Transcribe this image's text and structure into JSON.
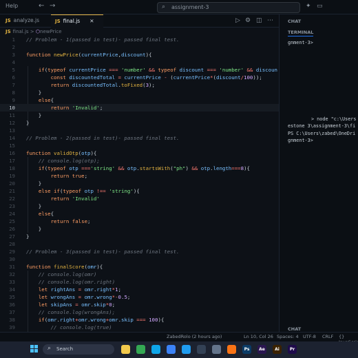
{
  "titlebar": {
    "menu_label": "Help",
    "back_label": "←",
    "forward_label": "→",
    "search_text": "assignment-3"
  },
  "tabs": [
    {
      "icon": "JS",
      "label": "analyze.js"
    },
    {
      "icon": "JS",
      "label": "final.js",
      "close": "✕"
    }
  ],
  "breadcrumb": {
    "icon": "JS",
    "file": "final.js",
    "separator": ">",
    "symbol": "newPrice"
  },
  "editor": {
    "cursor_line": 10,
    "lines": [
      {
        "n": "1",
        "t": [
          [
            "c",
            "// Problem - 1(passed in test)- passed final test."
          ]
        ]
      },
      {
        "n": "2",
        "t": []
      },
      {
        "n": "3",
        "t": [
          [
            "k",
            "function "
          ],
          [
            "f",
            "newPrice"
          ],
          [
            "p",
            "("
          ],
          [
            "v",
            "currentPrice"
          ],
          [
            "p",
            ","
          ],
          [
            "v",
            "discount"
          ],
          [
            "p",
            "){"
          ]
        ]
      },
      {
        "n": "4",
        "t": []
      },
      {
        "n": "5",
        "t": [
          [
            "p",
            "    "
          ],
          [
            "k",
            "if"
          ],
          [
            "p",
            "("
          ],
          [
            "k",
            "typeof "
          ],
          [
            "v",
            "currentPrice "
          ],
          [
            "o",
            "=== "
          ],
          [
            "s",
            "'number' "
          ],
          [
            "o",
            "&& "
          ],
          [
            "k",
            "typeof "
          ],
          [
            "v",
            "discount "
          ],
          [
            "o",
            "=== "
          ],
          [
            "s",
            "'number' "
          ],
          [
            "o",
            "&& "
          ],
          [
            "v",
            "discoun"
          ]
        ]
      },
      {
        "n": "6",
        "t": [
          [
            "p",
            "        "
          ],
          [
            "k",
            "const "
          ],
          [
            "v",
            "discountedTotal "
          ],
          [
            "o",
            "= "
          ],
          [
            "v",
            "currentPrice "
          ],
          [
            "o",
            "- "
          ],
          [
            "p",
            "("
          ],
          [
            "v",
            "currentPrice"
          ],
          [
            "o",
            "*"
          ],
          [
            "p",
            "("
          ],
          [
            "v",
            "discount"
          ],
          [
            "o",
            "/"
          ],
          [
            "n",
            "100"
          ],
          [
            "p",
            "));"
          ]
        ]
      },
      {
        "n": "7",
        "t": [
          [
            "p",
            "        "
          ],
          [
            "k",
            "return "
          ],
          [
            "v",
            "discountedTotal"
          ],
          [
            "p",
            "."
          ],
          [
            "f",
            "toFixed"
          ],
          [
            "p",
            "("
          ],
          [
            "n",
            "3"
          ],
          [
            "p",
            ");"
          ]
        ]
      },
      {
        "n": "8",
        "t": [
          [
            "p",
            "    }"
          ]
        ]
      },
      {
        "n": "9",
        "t": [
          [
            "p",
            "    "
          ],
          [
            "k",
            "else"
          ],
          [
            "p",
            "{"
          ]
        ]
      },
      {
        "n": "10",
        "t": [
          [
            "p",
            "        "
          ],
          [
            "k",
            "return "
          ],
          [
            "s",
            "'Invalid'"
          ],
          [
            "p",
            ";"
          ]
        ]
      },
      {
        "n": "11",
        "t": [
          [
            "p",
            "    }"
          ]
        ]
      },
      {
        "n": "12",
        "t": [
          [
            "p",
            "}"
          ]
        ]
      },
      {
        "n": "13",
        "t": []
      },
      {
        "n": "14",
        "t": [
          [
            "c",
            "// Problem - 2(passed in test)- passed final test."
          ]
        ]
      },
      {
        "n": "15",
        "t": []
      },
      {
        "n": "16",
        "t": [
          [
            "k",
            "function "
          ],
          [
            "f",
            "validOtp"
          ],
          [
            "p",
            "("
          ],
          [
            "v",
            "otp"
          ],
          [
            "p",
            "){"
          ]
        ]
      },
      {
        "n": "17",
        "t": [
          [
            "p",
            "    "
          ],
          [
            "c",
            "// console.log(otp);"
          ]
        ]
      },
      {
        "n": "18",
        "t": [
          [
            "p",
            "    "
          ],
          [
            "k",
            "if"
          ],
          [
            "p",
            "("
          ],
          [
            "k",
            "typeof "
          ],
          [
            "v",
            "otp "
          ],
          [
            "o",
            "==="
          ],
          [
            "s",
            "'string' "
          ],
          [
            "o",
            "&& "
          ],
          [
            "v",
            "otp"
          ],
          [
            "p",
            "."
          ],
          [
            "f",
            "startsWith"
          ],
          [
            "p",
            "("
          ],
          [
            "s",
            "\"ph\""
          ],
          [
            "p",
            ") "
          ],
          [
            "o",
            "&& "
          ],
          [
            "v",
            "otp"
          ],
          [
            "p",
            "."
          ],
          [
            "v",
            "length"
          ],
          [
            "o",
            "==="
          ],
          [
            "n",
            "8"
          ],
          [
            "p",
            "){"
          ]
        ]
      },
      {
        "n": "19",
        "t": [
          [
            "p",
            "        "
          ],
          [
            "k",
            "return "
          ],
          [
            "k",
            "true"
          ],
          [
            "p",
            ";"
          ]
        ]
      },
      {
        "n": "20",
        "t": [
          [
            "p",
            "    }"
          ]
        ]
      },
      {
        "n": "21",
        "t": [
          [
            "p",
            "    "
          ],
          [
            "k",
            "else if"
          ],
          [
            "p",
            "("
          ],
          [
            "k",
            "typeof "
          ],
          [
            "v",
            "otp "
          ],
          [
            "o",
            "!== "
          ],
          [
            "s",
            "'string'"
          ],
          [
            "p",
            "){"
          ]
        ]
      },
      {
        "n": "22",
        "t": [
          [
            "p",
            "        "
          ],
          [
            "k",
            "return "
          ],
          [
            "s",
            "'Invalid'"
          ]
        ]
      },
      {
        "n": "23",
        "t": [
          [
            "p",
            "    }"
          ]
        ]
      },
      {
        "n": "24",
        "t": [
          [
            "p",
            "    "
          ],
          [
            "k",
            "else"
          ],
          [
            "p",
            "{"
          ]
        ]
      },
      {
        "n": "25",
        "t": [
          [
            "p",
            "        "
          ],
          [
            "k",
            "return "
          ],
          [
            "k",
            "false"
          ],
          [
            "p",
            ";"
          ]
        ]
      },
      {
        "n": "26",
        "t": [
          [
            "p",
            "    }"
          ]
        ]
      },
      {
        "n": "27",
        "t": [
          [
            "p",
            "}"
          ]
        ]
      },
      {
        "n": "28",
        "t": []
      },
      {
        "n": "29",
        "t": [
          [
            "c",
            "// Problem - 3(passed in test)- passed final test."
          ]
        ]
      },
      {
        "n": "30",
        "t": []
      },
      {
        "n": "31",
        "t": [
          [
            "k",
            "function "
          ],
          [
            "f",
            "finalScore"
          ],
          [
            "p",
            "("
          ],
          [
            "v",
            "omr"
          ],
          [
            "p",
            "){"
          ]
        ]
      },
      {
        "n": "32",
        "t": [
          [
            "p",
            "    "
          ],
          [
            "c",
            "// console.log(omr)"
          ]
        ]
      },
      {
        "n": "33",
        "t": [
          [
            "p",
            "    "
          ],
          [
            "c",
            "// console.log(omr.right)"
          ]
        ]
      },
      {
        "n": "34",
        "t": [
          [
            "p",
            "    "
          ],
          [
            "k",
            "let "
          ],
          [
            "v",
            "rightAns "
          ],
          [
            "o",
            "= "
          ],
          [
            "v",
            "omr"
          ],
          [
            "p",
            "."
          ],
          [
            "v",
            "right"
          ],
          [
            "o",
            "*"
          ],
          [
            "n",
            "1"
          ],
          [
            "p",
            ";"
          ]
        ]
      },
      {
        "n": "35",
        "t": [
          [
            "p",
            "    "
          ],
          [
            "k",
            "let "
          ],
          [
            "v",
            "wrongAns "
          ],
          [
            "o",
            "= "
          ],
          [
            "v",
            "omr"
          ],
          [
            "p",
            "."
          ],
          [
            "v",
            "wrong"
          ],
          [
            "o",
            "*-"
          ],
          [
            "n",
            "0.5"
          ],
          [
            "p",
            ";"
          ]
        ]
      },
      {
        "n": "36",
        "t": [
          [
            "p",
            "    "
          ],
          [
            "k",
            "let "
          ],
          [
            "v",
            "skipAns "
          ],
          [
            "o",
            "= "
          ],
          [
            "v",
            "omr"
          ],
          [
            "p",
            "."
          ],
          [
            "v",
            "skip"
          ],
          [
            "o",
            "*"
          ],
          [
            "n",
            "0"
          ],
          [
            "p",
            ";"
          ]
        ]
      },
      {
        "n": "37",
        "t": [
          [
            "p",
            "    "
          ],
          [
            "c",
            "// console.log(wrongAns);"
          ]
        ]
      },
      {
        "n": "38",
        "t": [
          [
            "p",
            "    "
          ],
          [
            "k",
            "if"
          ],
          [
            "p",
            "("
          ],
          [
            "v",
            "omr"
          ],
          [
            "p",
            "."
          ],
          [
            "v",
            "right"
          ],
          [
            "o",
            "+"
          ],
          [
            "v",
            "omr"
          ],
          [
            "p",
            "."
          ],
          [
            "v",
            "wrong"
          ],
          [
            "o",
            "+"
          ],
          [
            "v",
            "omr"
          ],
          [
            "p",
            "."
          ],
          [
            "v",
            "skip "
          ],
          [
            "o",
            "=== "
          ],
          [
            "n",
            "100"
          ],
          [
            "p",
            "){"
          ]
        ]
      },
      {
        "n": "39",
        "t": [
          [
            "p",
            "        "
          ],
          [
            "c",
            "// console.log(true)"
          ]
        ]
      },
      {
        "n": "40",
        "t": []
      }
    ]
  },
  "side_panel": {
    "chat_header": "CHAT",
    "terminal_header": "TERMINAL",
    "chat_footer": "CHAT",
    "terminal_lines": [
      {
        "text": "gnment-3>",
        "style": "p"
      },
      {
        "text": "> node \"c:\\Users",
        "style": "p"
      },
      {
        "text": "estone 3\\assignment-3\\fi",
        "style": "p"
      },
      {
        "text": "PS C:\\Users\\zabed\\OneDri",
        "style": "p"
      },
      {
        "text": "gnment-3>",
        "style": "p"
      }
    ]
  },
  "statusbar": {
    "blame": "ZabedRolo (2 hours ago)",
    "position": "Ln 10, Col 26",
    "spaces": "Spaces: 4",
    "encoding": "UTF-8",
    "eol": "CRLF",
    "language": "{} JavaScript"
  },
  "taskbar": {
    "search_placeholder": "Search",
    "apps": [
      {
        "name": "explorer",
        "label": "",
        "color": "#f2c94c"
      },
      {
        "name": "chrome",
        "label": "",
        "color": "#34a853"
      },
      {
        "name": "edge",
        "label": "",
        "color": "#0ea5e9"
      },
      {
        "name": "store",
        "label": "",
        "color": "#3b82f6"
      },
      {
        "name": "vscode",
        "label": "",
        "color": "#1f9cf0"
      },
      {
        "name": "terminal",
        "label": "",
        "color": "#334155"
      },
      {
        "name": "settings",
        "label": "",
        "color": "#64748b"
      },
      {
        "name": "brave",
        "label": "",
        "color": "#f97316"
      },
      {
        "name": "photoshop",
        "label": "Ps",
        "color": "#0b3b66"
      },
      {
        "name": "after-effects",
        "label": "Ae",
        "color": "#2a1650"
      },
      {
        "name": "illustrator",
        "label": "Ai",
        "color": "#3b2200"
      },
      {
        "name": "premiere",
        "label": "Pr",
        "color": "#1e0a4a"
      }
    ]
  },
  "colors": {
    "accent": "#e3b341",
    "editor_bg": "#0d1117",
    "keyword": "#ff9e64",
    "function": "#e3b341",
    "string": "#7ee787",
    "comment": "#6e7681"
  }
}
